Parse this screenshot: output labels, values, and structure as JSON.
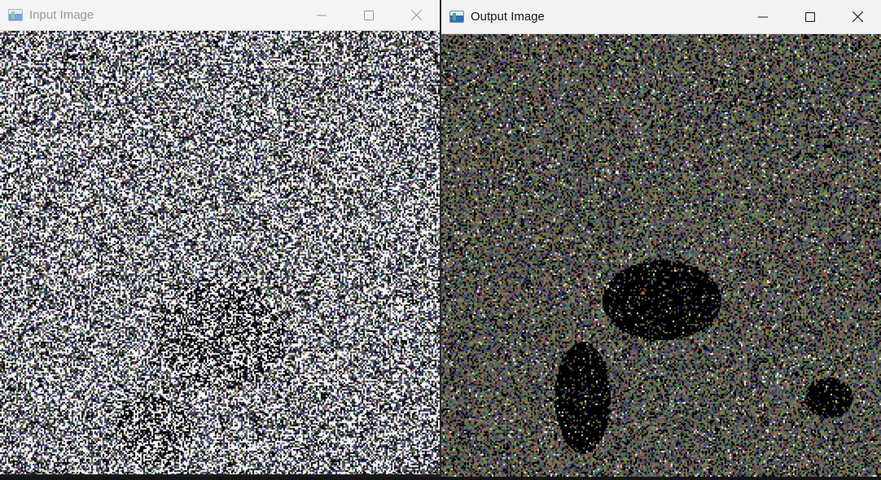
{
  "windows": {
    "input": {
      "title": "Input Image",
      "controls": [
        "minimize-icon",
        "maximize-icon",
        "close-icon"
      ],
      "title_color": "#9a9a9a",
      "image": {
        "description_id": "noisy-satellite-texture",
        "noise_density": 0.42,
        "dark_region": "lower-center"
      }
    },
    "output": {
      "title": "Output Image",
      "controls": [
        "minimize-icon",
        "maximize-icon",
        "close-icon"
      ],
      "title_color": "#1a1a1a",
      "image": {
        "description_id": "filtered-satellite-texture",
        "noise_density": 0.08,
        "dark_region": "center"
      }
    }
  },
  "colors": {
    "titlebar_inactive": "#f4f4f4",
    "titlebar_active": "#f2f2f2",
    "image_dark": "#000000",
    "image_olive": "#8c8a6a",
    "image_slate": "#4a4e70",
    "image_white": "#f4f4f4"
  }
}
